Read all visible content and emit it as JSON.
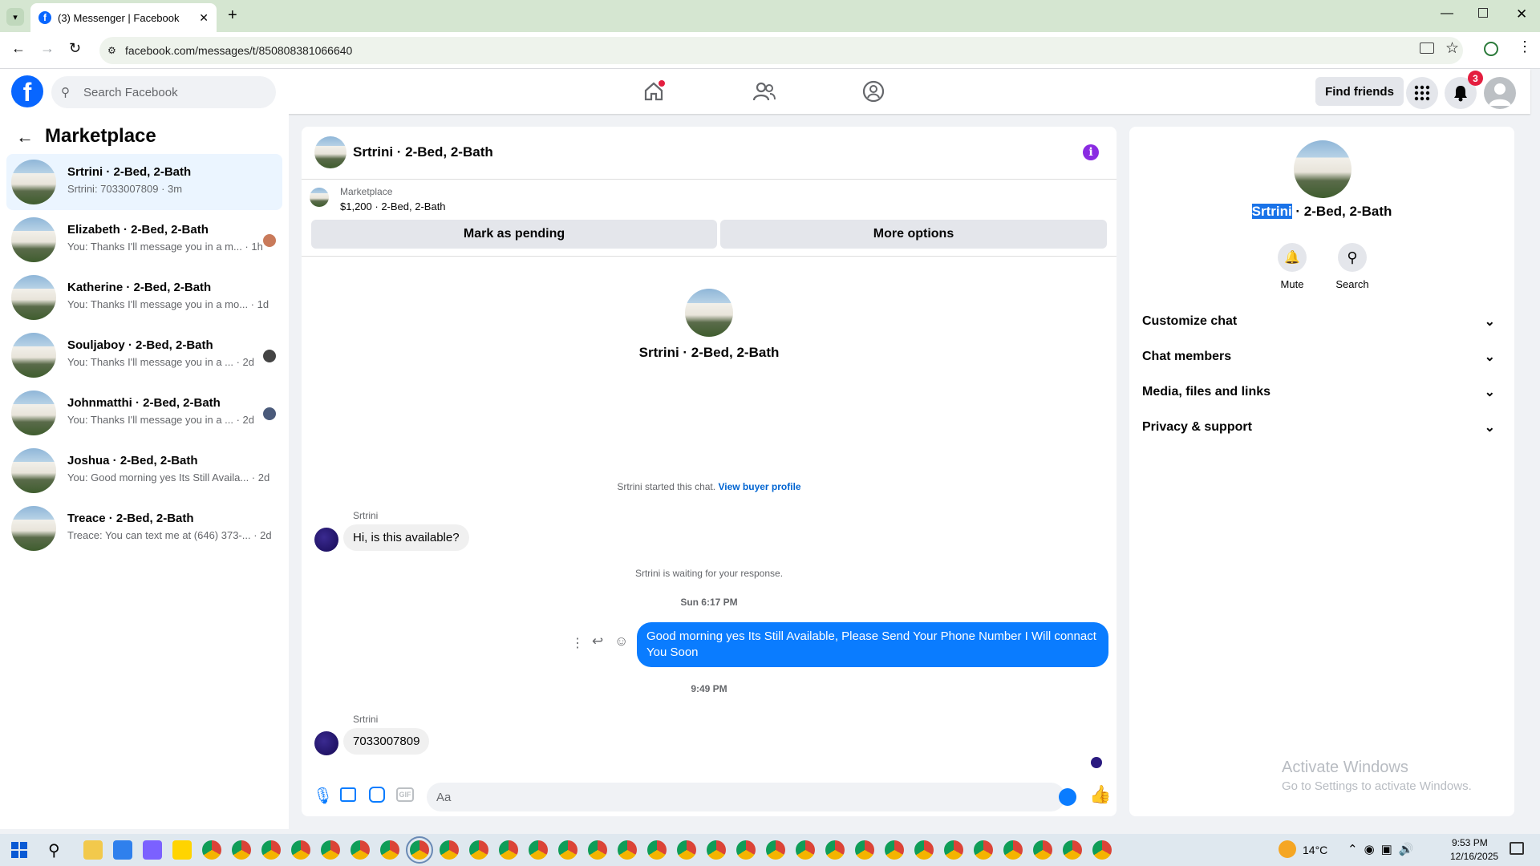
{
  "browser": {
    "tab_title": "(3) Messenger | Facebook",
    "url": "facebook.com/messages/t/850808381066640"
  },
  "fb_header": {
    "search_placeholder": "Search Facebook",
    "find_friends": "Find friends",
    "notifications_count": "3"
  },
  "left": {
    "title": "Marketplace",
    "chats": [
      {
        "name": "Srtrini · 2-Bed, 2-Bath",
        "preview": "Srtrini: 7033007809 · 3m",
        "active": true
      },
      {
        "name": "Elizabeth · 2-Bed, 2-Bath",
        "preview": "You: Thanks I'll message you in a m... · 1h"
      },
      {
        "name": "Katherine · 2-Bed, 2-Bath",
        "preview": "You: Thanks I'll message you in a mo... · 1d"
      },
      {
        "name": "Souljaboy · 2-Bed, 2-Bath",
        "preview": "You: Thanks I'll message you in a ... · 2d"
      },
      {
        "name": "Johnmatthi · 2-Bed, 2-Bath",
        "preview": "You: Thanks I'll message you in a ... · 2d"
      },
      {
        "name": "Joshua · 2-Bed, 2-Bath",
        "preview": "You: Good morning yes Its Still Availa... · 2d"
      },
      {
        "name": "Treace · 2-Bed, 2-Bath",
        "preview": "Treace: You can text me at (646) 373-... · 2d"
      }
    ]
  },
  "conversation": {
    "title": "Srtrini · 2-Bed, 2-Bath",
    "listing_source": "Marketplace",
    "listing_detail": "$1,200 · 2-Bed, 2-Bath",
    "mark_pending": "Mark as pending",
    "more_options": "More options",
    "intro_name": "Srtrini · 2-Bed, 2-Bath",
    "started_text": "Srtrini started this chat.",
    "view_buyer_profile": "View buyer profile",
    "sender_name": "Srtrini",
    "msg1": "Hi, is this available?",
    "waiting": "Srtrini is waiting for your response.",
    "time1": "Sun 6:17 PM",
    "msg2": "Good morning yes  Its Still Available, Please Send Your Phone Number I Will connact You Soon",
    "time2": "9:49 PM",
    "sender_name2": "Srtrini",
    "msg3": "7033007809",
    "composer_placeholder": "Aa"
  },
  "right": {
    "name_highlight": "Srtrini",
    "name_rest": " · 2-Bed, 2-Bath",
    "mute": "Mute",
    "search": "Search",
    "sections": [
      "Customize chat",
      "Chat members",
      "Media, files and links",
      "Privacy & support"
    ]
  },
  "watermark": {
    "line1": "Activate Windows",
    "line2": "Go to Settings to activate Windows."
  },
  "taskbar": {
    "weather": "14°C",
    "time": "9:53 PM",
    "date": "12/16/2025"
  },
  "colors": {
    "fb_blue": "#0866ff",
    "messenger_blue": "#0a7cff",
    "info_purple": "#8a2be2"
  }
}
